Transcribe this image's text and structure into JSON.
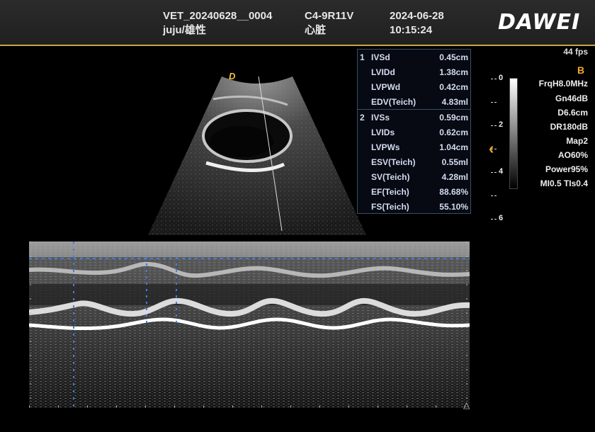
{
  "header": {
    "patient_id": "VET_20240628__0004",
    "patient_name": "juju/雄性",
    "probe": "C4-9R11V",
    "preset": "心脏",
    "date": "2024-06-28",
    "time": "10:15:24",
    "brand": "DAWEI"
  },
  "sector_marker": "D",
  "measurements": {
    "group1_number": "1",
    "group2_number": "2",
    "rows": [
      {
        "label": "IVSd",
        "value": "0.45cm"
      },
      {
        "label": "LVIDd",
        "value": "1.38cm"
      },
      {
        "label": "LVPWd",
        "value": "0.42cm"
      },
      {
        "label": "EDV(Teich)",
        "value": "4.83ml"
      },
      {
        "label": "IVSs",
        "value": "0.59cm"
      },
      {
        "label": "LVIDs",
        "value": "0.62cm"
      },
      {
        "label": "LVPWs",
        "value": "1.04cm"
      },
      {
        "label": "ESV(Teich)",
        "value": "0.55ml"
      },
      {
        "label": "SV(Teich)",
        "value": "4.28ml"
      },
      {
        "label": "EF(Teich)",
        "value": "88.68%"
      },
      {
        "label": "FS(Teich)",
        "value": "55.10%"
      }
    ]
  },
  "params": {
    "fps": "44 fps",
    "mode": "B",
    "frequency": "FrqH8.0MHz",
    "gain": "Gn46dB",
    "depth": "D6.6cm",
    "dynamic_range": "DR180dB",
    "map": "Map2",
    "ao": "AO60%",
    "power": "Power95%",
    "mi_tis": "MI0.5 TIs0.4"
  },
  "depth_scale": [
    "0",
    "2",
    "4",
    "6"
  ],
  "colors": {
    "accent": "#c9a33c",
    "mode_orange": "#f2a82e",
    "measurement_text": "#d4dcf0",
    "caliper_blue": "#3f7fe0"
  }
}
